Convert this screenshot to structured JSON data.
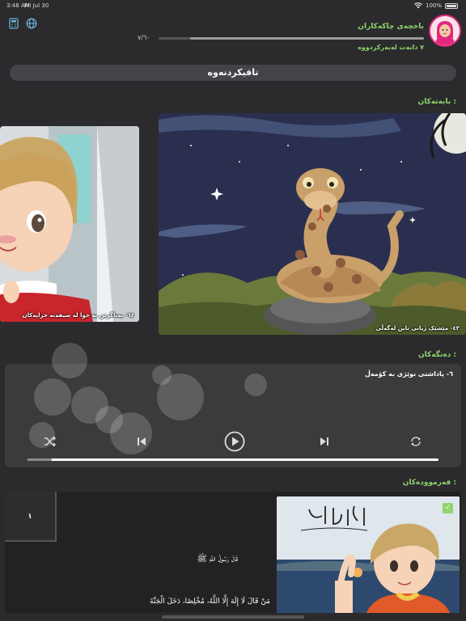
{
  "status_bar": {
    "time": "3:48 AM",
    "date": "Fri Jul 30",
    "battery": "100%",
    "battery_level": 1.0
  },
  "header": {
    "user_name": "باخچەی چاکەکاران",
    "progress_text": "٧/٦٠",
    "progress_fraction": 0.88,
    "badges_text": "٧ دانەت لەبەرکردووە",
    "icons": [
      "calculator-icon",
      "globe-icon"
    ]
  },
  "title": "تاقیکردنەوە",
  "sections": {
    "stories": "بابەتەکان :",
    "sounds": "دەنگەکان :",
    "hadiths": "فەرموودەکان :"
  },
  "stories": [
    {
      "caption": "٦٤- پەناگرتن بە خوا لە سیفەتە خراپەکان"
    },
    {
      "caption": "٤٣- مێشێک ژیانی تاین لەگەڵی"
    }
  ],
  "audio": {
    "track_title": "٦- پاداشتی نوێژی بە کۆمەڵ",
    "progress_fraction": 0.06,
    "controls": [
      "shuffle-icon",
      "skip-back-icon",
      "play-icon",
      "skip-forward-icon",
      "repeat-icon"
    ]
  },
  "hadith": {
    "number": "١",
    "title": "قَالَ رَسُولُ اللَّهِ ﷺ",
    "text": "مَنْ قَالَ لَا إِلَهَ إِلَّا اللَّهُ، مُخْلِصًا، دَخَلَ الْجَنَّةَ",
    "checked": true
  },
  "colors": {
    "accent": "#8fd56b",
    "background": "#2b2b2d",
    "card": "#3b3b3e",
    "avatar_border": "#e0297e"
  }
}
